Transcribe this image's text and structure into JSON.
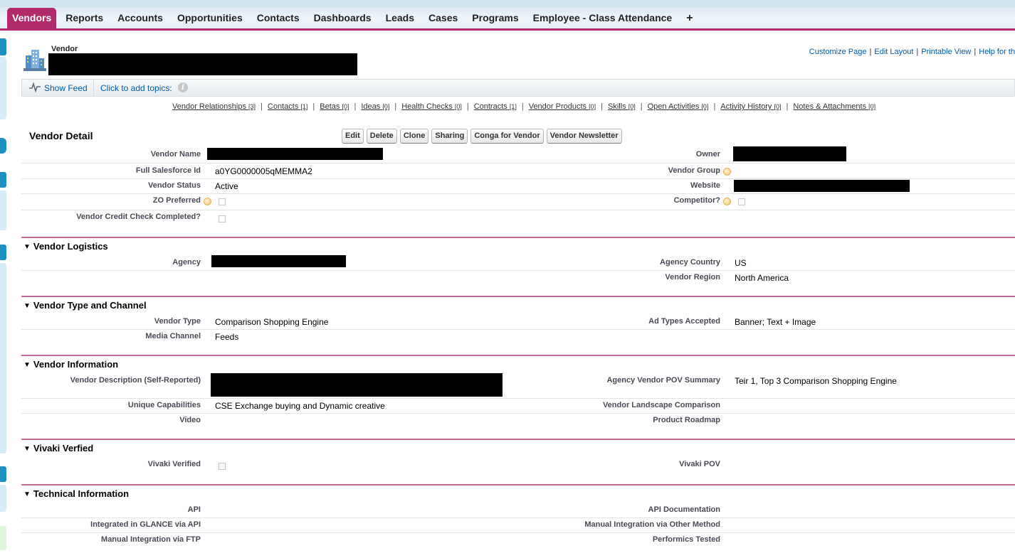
{
  "tabs": [
    {
      "label": "Vendors",
      "active": true
    },
    {
      "label": "Reports"
    },
    {
      "label": "Accounts"
    },
    {
      "label": "Opportunities"
    },
    {
      "label": "Contacts"
    },
    {
      "label": "Dashboards"
    },
    {
      "label": "Leads"
    },
    {
      "label": "Cases"
    },
    {
      "label": "Programs"
    },
    {
      "label": "Employee - Class Attendance"
    },
    {
      "label": "+"
    }
  ],
  "colors": {
    "accent": "#b12b6b",
    "link": "#015ba7",
    "section_line": "#c06b97"
  },
  "header": {
    "entity_label": "Vendor",
    "entity_icon": "building-icon",
    "links": [
      "Customize Page",
      "Edit Layout",
      "Printable View",
      "Help for th"
    ]
  },
  "feed": {
    "show_feed": "Show Feed",
    "add_topics": "Click to add topics:",
    "info_icon": "i"
  },
  "related_links": [
    {
      "label": "Vendor Relationships",
      "count": "[3]"
    },
    {
      "label": "Contacts",
      "count": "[1]"
    },
    {
      "label": "Betas",
      "count": "[0]"
    },
    {
      "label": "Ideas",
      "count": "[0]"
    },
    {
      "label": "Health Checks",
      "count": "[0]"
    },
    {
      "label": "Contracts",
      "count": "[1]"
    },
    {
      "label": "Vendor Products",
      "count": "[0]"
    },
    {
      "label": "Skills",
      "count": "[0]"
    },
    {
      "label": "Open Activities",
      "count": "[0]"
    },
    {
      "label": "Activity History",
      "count": "[0]"
    },
    {
      "label": "Notes & Attachments",
      "count": "[0]"
    }
  ],
  "detail": {
    "title": "Vendor Detail",
    "buttons": [
      "Edit",
      "Delete",
      "Clone",
      "Sharing",
      "Conga for Vendor",
      "Vendor Newsletter"
    ]
  },
  "fields": {
    "vendor_name": "Vendor Name",
    "owner": "Owner",
    "full_sf_id": "Full Salesforce Id",
    "full_sf_id_value": "a0YG0000005qMEMMA2",
    "vendor_group": "Vendor Group",
    "vendor_status": "Vendor Status",
    "vendor_status_value": "Active",
    "website": "Website",
    "zo_preferred": "ZO Preferred",
    "competitor": "Competitor?",
    "credit_check": "Vendor Credit Check Completed?"
  },
  "sections": {
    "logistics": {
      "title": "Vendor Logistics",
      "agency": "Agency",
      "agency_country": "Agency Country",
      "agency_country_value": "US",
      "vendor_region": "Vendor Region",
      "vendor_region_value": "North America"
    },
    "type_channel": {
      "title": "Vendor Type and Channel",
      "vendor_type": "Vendor Type",
      "vendor_type_value": "Comparison Shopping Engine",
      "ad_types": "Ad Types Accepted",
      "ad_types_value": "Banner; Text + Image",
      "media_channel": "Media Channel",
      "media_channel_value": "Feeds"
    },
    "information": {
      "title": "Vendor Information",
      "description": "Vendor Description (Self-Reported)",
      "pov_summary": "Agency Vendor POV Summary",
      "pov_summary_value": "Teir 1, Top 3 Comparison Shopping Engine",
      "unique_caps": "Unique Capabilities",
      "unique_caps_value": "CSE Exchange buying and Dynamic creative",
      "landscape": "Vendor Landscape Comparison",
      "video": "Video",
      "roadmap": "Product Roadmap"
    },
    "vivaki": {
      "title": "Vivaki Verfied",
      "verified": "Vivaki Verified",
      "pov": "Vivaki POV"
    },
    "technical": {
      "title": "Technical Information",
      "api": "API",
      "api_docs": "API Documentation",
      "glance": "Integrated in GLANCE via API",
      "manual_other": "Manual Integration via Other Method",
      "manual_ftp": "Manual Integration via FTP",
      "performics": "Performics Tested"
    }
  }
}
